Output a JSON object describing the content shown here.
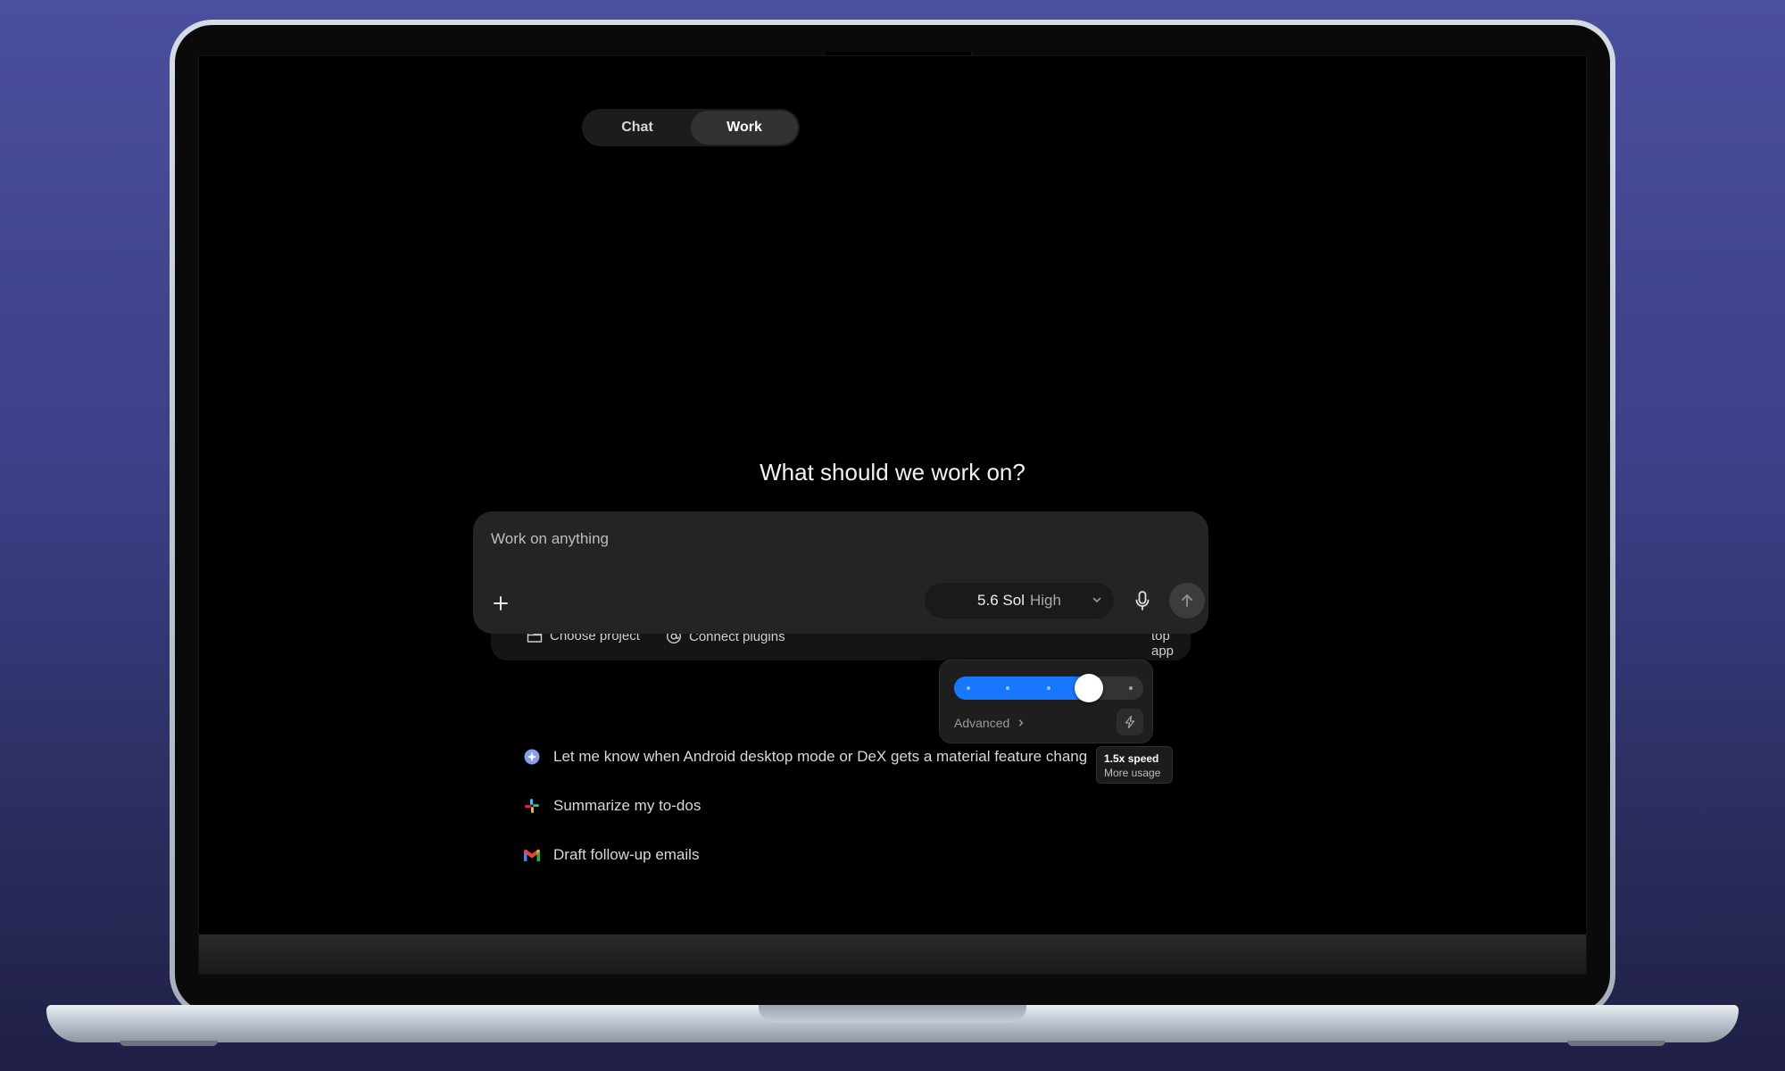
{
  "mode_toggle": {
    "tabs": [
      {
        "label": "Chat",
        "active": false
      },
      {
        "label": "Work",
        "active": true
      }
    ]
  },
  "heading": "What should we work on?",
  "composer": {
    "placeholder": "Work on anything",
    "model": {
      "name": "5.6 Sol",
      "level": "High"
    }
  },
  "strip": {
    "choose_project": "Choose project",
    "connect_plugins": "Connect plugins",
    "desktop_app_partial": "top app"
  },
  "popover": {
    "slider_value": 0.75,
    "advanced_label": "Advanced",
    "accent_color": "#1778ff"
  },
  "tooltip": {
    "title": "1.5x speed",
    "subtitle": "More usage"
  },
  "suggestions": [
    {
      "icon": "sparkle-icon",
      "label": "Let me know when Android desktop mode or DeX gets a material feature chang"
    },
    {
      "icon": "slack-icon",
      "label": "Summarize my to-dos"
    },
    {
      "icon": "gmail-icon",
      "label": "Draft follow-up emails"
    }
  ]
}
